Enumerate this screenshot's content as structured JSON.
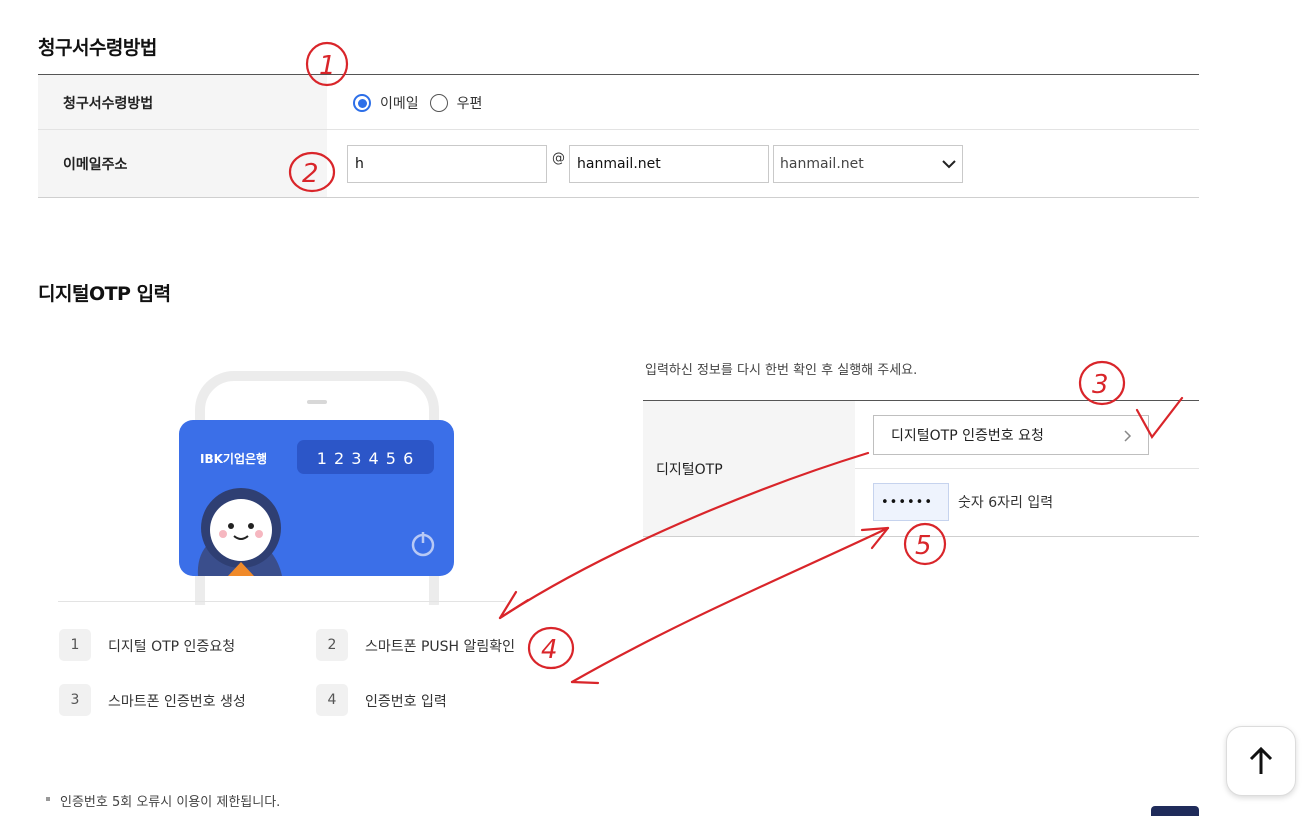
{
  "billing": {
    "section_title": "청구서수령방법",
    "method_label": "청구서수령방법",
    "options": [
      "이메일",
      "우편"
    ],
    "selected_option": "이메일",
    "email_label": "이메일주소",
    "email_local_value": "h",
    "at_symbol": "@",
    "email_domain_value": "hanmail.net",
    "domain_select_value": "hanmail.net"
  },
  "otp": {
    "section_title": "디지털OTP 입력",
    "notice": "입력하신 정보를 다시 한번 확인 후 실행해 주세요.",
    "row_label": "디지털OTP",
    "request_button": "디지털OTP 인증번호 요청",
    "code_value": "••••••",
    "code_hint": "숫자 6자리 입력",
    "card": {
      "bank_name": "IBK기업은행",
      "code_display": "1 2 3 4 5 6"
    },
    "steps": [
      {
        "num": "1",
        "label": "디지털 OTP 인증요청"
      },
      {
        "num": "2",
        "label": "스마트폰 PUSH 알림확인"
      },
      {
        "num": "3",
        "label": "스마트폰 인증번호 생성"
      },
      {
        "num": "4",
        "label": "인증번호 입력"
      }
    ],
    "footnote": "인증번호 5회 오류시 이용이 제한됩니다."
  },
  "annotations": [
    "1",
    "2",
    "3",
    "4",
    "5"
  ],
  "colors": {
    "accent": "#2d6fe8",
    "card": "#3b6fe8",
    "annotation": "#d9252a"
  },
  "icons": {
    "scroll_top": "arrow-up-icon",
    "select_arrow": "chevron-down-icon",
    "button_arrow": "chevron-right-icon",
    "card_power": "power-icon"
  }
}
